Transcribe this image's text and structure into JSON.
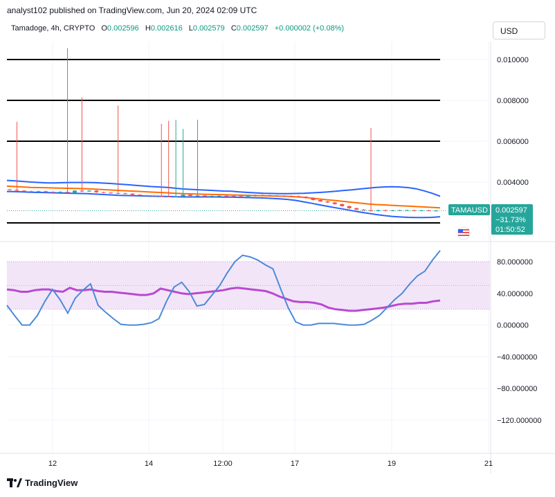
{
  "header": {
    "published": "analyst102 published on TradingView.com, Jun 20, 2024 02:09 UTC"
  },
  "legend": {
    "symbol": "Tamadoge, 4h, CRYPTO",
    "open_label": "O",
    "open": "0.002596",
    "high_label": "H",
    "high": "0.002616",
    "low_label": "L",
    "low": "0.002579",
    "close_label": "C",
    "close": "0.002597",
    "change": "+0.000002 (+0.08%)"
  },
  "currency": "USD",
  "price_tag": {
    "ticker": "TAMAUSD",
    "price": "0.002597",
    "change_pct": "−31.73%",
    "countdown": "01:50:52"
  },
  "footer": {
    "brand": "TradingView"
  },
  "colors": {
    "up": "#26a69a",
    "down": "#ef5350",
    "bb": "#2962ff",
    "basis": "#ff6d00",
    "k_line": "#4a8ad8",
    "d_line": "#b84ad0",
    "tag": "#26a69a"
  },
  "chart_data": [
    {
      "type": "candlestick",
      "title": "",
      "y_ticks": [
        "0.010000",
        "0.008000",
        "0.006000",
        "0.004000"
      ],
      "x_ticks": [
        "12",
        "14",
        "12:00",
        "17",
        "19",
        "21"
      ],
      "horizontal_levels": [
        0.01,
        0.008,
        0.006,
        0.002
      ],
      "current_price": 0.002597,
      "candles_close": [
        0.00362,
        0.00358,
        0.00355,
        0.00353,
        0.00355,
        0.00352,
        0.0035,
        0.00352,
        0.00348,
        0.00358,
        0.00354,
        0.00358,
        0.0035,
        0.00348,
        0.00346,
        0.00345,
        0.00343,
        0.00338,
        0.00335,
        0.00334,
        0.00332,
        0.0033,
        0.00328,
        0.0033,
        0.00338,
        0.00332,
        0.00334,
        0.0033,
        0.00332,
        0.00333,
        0.00332,
        0.00331,
        0.0033,
        0.00332,
        0.00336,
        0.00335,
        0.00334,
        0.00333,
        0.00332,
        0.00331,
        0.00328,
        0.00322,
        0.00312,
        0.00305,
        0.003,
        0.00292,
        0.00282,
        0.00272,
        0.00265,
        0.00262,
        0.00258,
        0.00262,
        0.0026,
        0.00261,
        0.00262,
        0.00262,
        0.0026,
        0.00261,
        0.0026,
        0.0026
      ],
      "wick_highs": [
        {
          "index": 1,
          "value": 0.00695
        },
        {
          "index": 8,
          "value": 0.01055
        },
        {
          "index": 10,
          "value": 0.00815
        },
        {
          "index": 15,
          "value": 0.00775
        },
        {
          "index": 21,
          "value": 0.00685
        },
        {
          "index": 22,
          "value": 0.007
        },
        {
          "index": 23,
          "value": 0.00705
        },
        {
          "index": 24,
          "value": 0.0066
        },
        {
          "index": 26,
          "value": 0.00705
        },
        {
          "index": 50,
          "value": 0.00665
        }
      ],
      "bollinger": {
        "upper": [
          0.00408,
          0.00406,
          0.00403,
          0.004,
          0.00398,
          0.00396,
          0.00396,
          0.00397,
          0.00398,
          0.00398,
          0.00398,
          0.00397,
          0.00395,
          0.00393,
          0.0039,
          0.00387,
          0.00384,
          0.00381,
          0.00378,
          0.00376,
          0.00374,
          0.0037,
          0.00366,
          0.00364,
          0.00362,
          0.0036,
          0.00358,
          0.00356,
          0.00355,
          0.00352,
          0.00349,
          0.00347,
          0.00345,
          0.00344,
          0.00343,
          0.00343,
          0.00344,
          0.00345,
          0.00347,
          0.00349,
          0.00352,
          0.00355,
          0.00359,
          0.00362,
          0.00366,
          0.0037,
          0.00374,
          0.00376,
          0.00377,
          0.00376,
          0.00373,
          0.00367,
          0.00357,
          0.00345,
          0.0033
        ],
        "basis": [
          0.0038,
          0.00378,
          0.00376,
          0.00374,
          0.00373,
          0.00372,
          0.00371,
          0.0037,
          0.00369,
          0.00368,
          0.00367,
          0.00365,
          0.00363,
          0.00361,
          0.00359,
          0.00357,
          0.00355,
          0.00353,
          0.00351,
          0.00349,
          0.00347,
          0.00345,
          0.00343,
          0.00342,
          0.00341,
          0.0034,
          0.00339,
          0.00338,
          0.00337,
          0.00336,
          0.00335,
          0.00334,
          0.00333,
          0.00332,
          0.00331,
          0.0033,
          0.00328,
          0.00325,
          0.00321,
          0.00317,
          0.00313,
          0.00309,
          0.00305,
          0.00301,
          0.00297,
          0.00293,
          0.0029,
          0.00288,
          0.00286,
          0.00284,
          0.00282,
          0.0028,
          0.00278,
          0.00276,
          0.00274
        ],
        "lower": [
          0.00354,
          0.00353,
          0.00352,
          0.0035,
          0.00349,
          0.00348,
          0.00347,
          0.00346,
          0.00345,
          0.00344,
          0.00343,
          0.00341,
          0.00339,
          0.00337,
          0.00335,
          0.00334,
          0.00333,
          0.00332,
          0.00331,
          0.0033,
          0.00329,
          0.00328,
          0.00327,
          0.00327,
          0.00327,
          0.00327,
          0.00327,
          0.00326,
          0.00326,
          0.00325,
          0.00324,
          0.00323,
          0.00322,
          0.0032,
          0.00318,
          0.00315,
          0.0031,
          0.00303,
          0.00296,
          0.00288,
          0.00281,
          0.00274,
          0.00267,
          0.0026,
          0.00253,
          0.00247,
          0.00241,
          0.00236,
          0.00232,
          0.00229,
          0.00227,
          0.00226,
          0.00226,
          0.00227,
          0.0023
        ]
      }
    },
    {
      "type": "line",
      "title": "",
      "y_ticks": [
        "80.000000",
        "40.000000",
        "0.000000",
        "−40.000000",
        "−80.000000",
        "−120.000000"
      ],
      "band": [
        20,
        80
      ],
      "middle_line": 50,
      "series": [
        {
          "values": [
            25,
            12,
            0,
            0,
            12,
            30,
            45,
            32,
            15,
            34,
            44,
            52,
            25,
            16,
            8,
            1,
            0,
            0,
            1,
            3,
            8,
            30,
            48,
            54,
            42,
            24,
            26,
            38,
            50,
            66,
            80,
            88,
            86,
            82,
            76,
            71,
            46,
            22,
            4,
            0,
            0,
            2,
            2,
            2,
            1,
            0,
            0,
            1,
            6,
            12,
            22,
            32,
            40,
            52,
            62,
            68,
            82,
            94
          ]
        },
        {
          "values": [
            45,
            44,
            42,
            42,
            44,
            45,
            45,
            43,
            42,
            47,
            44,
            44,
            45,
            43,
            42,
            42,
            41,
            40,
            39,
            38,
            38,
            40,
            46,
            44,
            42,
            40,
            39,
            40,
            41,
            42,
            43,
            44,
            46,
            47,
            46,
            45,
            44,
            43,
            40,
            36,
            33,
            30,
            29,
            29,
            28,
            26,
            22,
            20,
            19,
            18,
            18,
            19,
            20,
            21,
            22,
            24,
            26,
            27,
            27,
            28,
            28,
            30,
            31
          ]
        }
      ]
    }
  ]
}
